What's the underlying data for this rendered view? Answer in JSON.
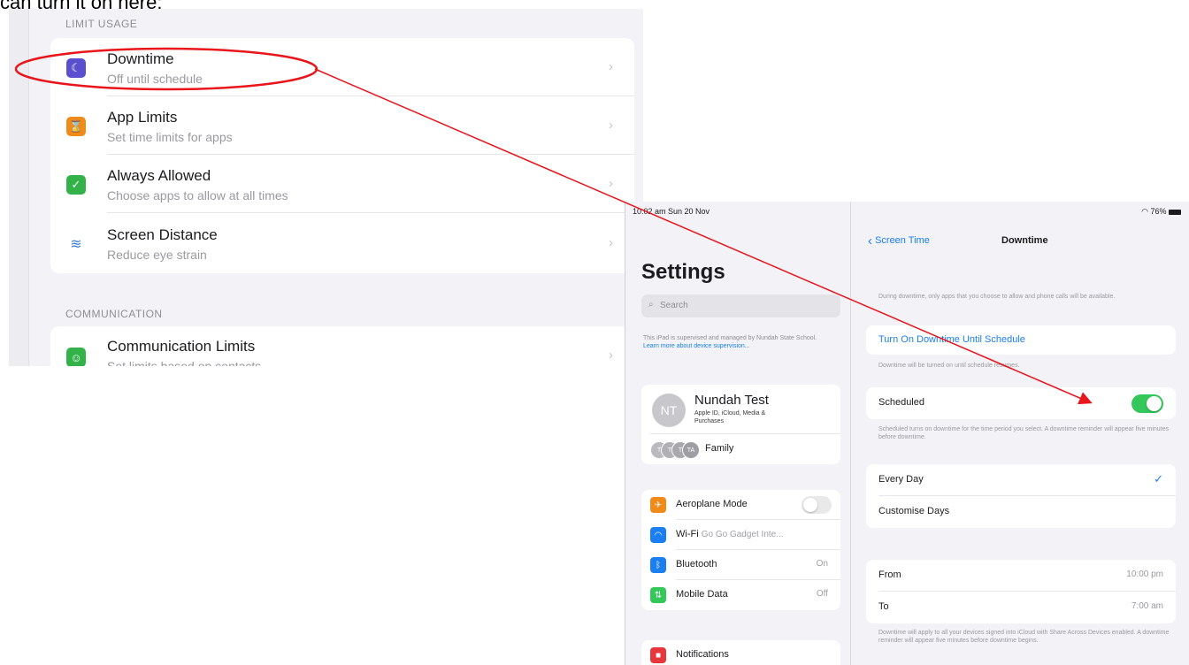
{
  "caption": "can turn it on here:",
  "screen_time_crop": {
    "limit_usage_header": "LIMIT USAGE",
    "items": [
      {
        "title": "Downtime",
        "subtitle": "Off until schedule",
        "icon": "downtime-moon-icon",
        "color": "#5a4fcf"
      },
      {
        "title": "App Limits",
        "subtitle": "Set time limits for apps",
        "icon": "hourglass-icon",
        "color": "#f08a19"
      },
      {
        "title": "Always Allowed",
        "subtitle": "Choose apps to allow at all times",
        "icon": "checkmark-shield-icon",
        "color": "#34b24a"
      },
      {
        "title": "Screen Distance",
        "subtitle": "Reduce eye strain",
        "icon": "screen-distance-icon",
        "color": "#3a7bd5"
      }
    ],
    "communication_header": "COMMUNICATION",
    "communication_item": {
      "title": "Communication Limits",
      "subtitle": "Set limits based on contacts",
      "icon": "person-bubble-icon",
      "color": "#34b24a"
    }
  },
  "ipad": {
    "status_time": "10:02 am  Sun 20 Nov",
    "status_battery": "76%",
    "sidebar": {
      "title": "Settings",
      "search_placeholder": "Search",
      "supervised_text": "This iPad is supervised and managed by Nundah State School.",
      "supervised_link": "Learn more about device supervision...",
      "profile_initials": "NT",
      "profile_name": "Nundah Test",
      "profile_sub": "Apple ID, iCloud, Media & Purchases",
      "family_label": "Family",
      "family_avatars": [
        "T",
        "T",
        "T",
        "TA"
      ],
      "items": [
        {
          "label": "Aeroplane Mode",
          "value": "",
          "icon": "airplane-icon",
          "color": "#f08a19"
        },
        {
          "label": "Wi-Fi",
          "value": "Go Go Gadget Inte...",
          "icon": "wifi-icon",
          "color": "#1b7ff2"
        },
        {
          "label": "Bluetooth",
          "value": "On",
          "icon": "bluetooth-icon",
          "color": "#1b7ff2"
        },
        {
          "label": "Mobile Data",
          "value": "Off",
          "icon": "mobile-data-icon",
          "color": "#34c759"
        }
      ],
      "notifications_label": "Notifications",
      "aeroplane_on": false
    },
    "detail": {
      "back_label": "Screen Time",
      "title": "Downtime",
      "intro": "During downtime, only apps that you choose to allow and phone calls will be available.",
      "turn_on_label": "Turn On Downtime Until Schedule",
      "turn_on_footer": "Downtime will be turned on until schedule resumes.",
      "scheduled_label": "Scheduled",
      "scheduled_on": true,
      "scheduled_footer": "Scheduled turns on downtime for the time period you select. A downtime reminder will appear five minutes before downtime.",
      "every_day_label": "Every Day",
      "customise_label": "Customise Days",
      "from_label": "From",
      "from_value": "10:00 pm",
      "to_label": "To",
      "to_value": "7:00 am",
      "bottom_footer": "Downtime will apply to all your devices signed into iCloud with Share Across Devices enabled. A downtime reminder will appear five minutes before downtime begins."
    }
  },
  "colors": {
    "accent": "#1b7ff2",
    "toggle_on": "#34c759",
    "annotation": "#e8151b"
  }
}
